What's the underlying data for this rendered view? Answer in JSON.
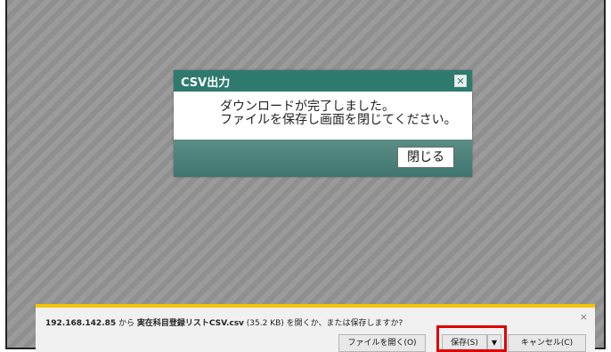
{
  "dialog": {
    "title": "CSV出力",
    "close_icon": "✕",
    "message_line1": "ダウンロードが完了しました。",
    "message_line2": "ファイルを保存し画面を閉じてください。",
    "close_button": "閉じる"
  },
  "download_bar": {
    "host": "192.168.142.85",
    "from": " から ",
    "filename": "実在科目登録リストCSV.csv",
    "prompt": " (35.2 KB) を開くか、または保存しますか?",
    "close_icon": "×",
    "open_button": "ファイルを開く(O)",
    "save_button": "保存(S)",
    "save_dropdown": "▼",
    "cancel_button": "キャンセル(C)"
  },
  "colors": {
    "dialog_header": "#2f7a6f",
    "highlight": "#e00000",
    "bar_accent": "#f5c400"
  }
}
